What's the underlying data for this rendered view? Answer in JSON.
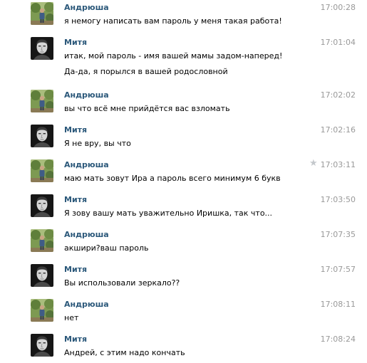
{
  "messages": [
    {
      "author": "Андрюша",
      "avatar": "andryusha",
      "time": "17:00:28",
      "lines": [
        "я немогу написать вам пароль у меня такая работа!"
      ]
    },
    {
      "author": "Митя",
      "avatar": "mitya",
      "time": "17:01:04",
      "lines": [
        "итак, мой пароль - имя вашей мамы задом-наперед!",
        "Да-да, я порылся в вашей родословной"
      ]
    },
    {
      "author": "Андрюша",
      "avatar": "andryusha",
      "time": "17:02:02",
      "lines": [
        "вы что всё мне прийдётся вас взломать"
      ]
    },
    {
      "author": "Митя",
      "avatar": "mitya",
      "time": "17:02:16",
      "lines": [
        "Я не вру, вы что"
      ]
    },
    {
      "author": "Андрюша",
      "avatar": "andryusha",
      "time": "17:03:11",
      "star": "star-icon",
      "lines": [
        "маю мать зовут Ира а пароль всего минимум 6 букв"
      ]
    },
    {
      "author": "Митя",
      "avatar": "mitya",
      "time": "17:03:50",
      "lines": [
        "Я зову вашу мать уважительно Иришка, так что..."
      ]
    },
    {
      "author": "Андрюша",
      "avatar": "andryusha",
      "time": "17:07:35",
      "lines": [
        "акшири?ваш пароль"
      ]
    },
    {
      "author": "Митя",
      "avatar": "mitya",
      "time": "17:07:57",
      "lines": [
        "Вы использовали зеркало??"
      ]
    },
    {
      "author": "Андрюша",
      "avatar": "andryusha",
      "time": "17:08:11",
      "lines": [
        "нет"
      ]
    },
    {
      "author": "Митя",
      "avatar": "mitya",
      "time": "17:08:24",
      "lines": [
        "Андрей, с этим надо кончать"
      ]
    }
  ],
  "colors": {
    "author": "#2b587a",
    "time": "#999999",
    "text": "#000000",
    "star": "#c4c8cc"
  }
}
